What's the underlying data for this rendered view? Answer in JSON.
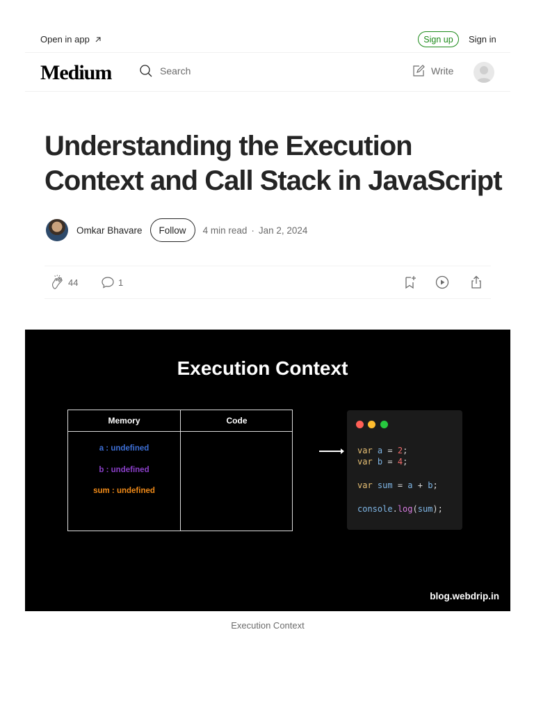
{
  "topbar": {
    "open_app": "Open in app",
    "sign_up": "Sign up",
    "sign_in": "Sign in"
  },
  "header": {
    "logo": "Medium",
    "search_label": "Search",
    "write_label": "Write"
  },
  "article": {
    "title": "Understanding the Execution Context and Call Stack in JavaScript",
    "author": "Omkar Bhavare",
    "follow": "Follow",
    "read_time": "4 min read",
    "separator": "·",
    "date": "Jan 2, 2024",
    "claps": "44",
    "responses": "1"
  },
  "hero": {
    "title": "Execution Context",
    "memory_header": "Memory",
    "code_header": "Code",
    "memory_lines": [
      {
        "text": "a : undefined",
        "color": "#3d6fd6"
      },
      {
        "text": "b : undefined",
        "color": "#8a3fc8"
      },
      {
        "text": "sum : undefined",
        "color": "#f08a18"
      }
    ],
    "window_dots": [
      "#ff5f56",
      "#ffbd2e",
      "#27c93f"
    ],
    "watermark": "blog.webdrip.in"
  },
  "caption": "Execution Context"
}
